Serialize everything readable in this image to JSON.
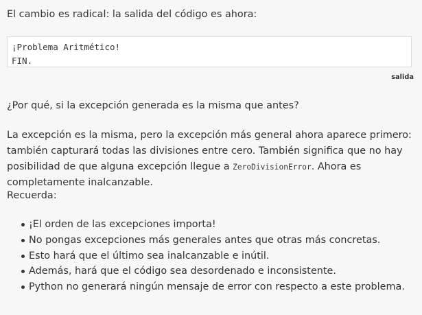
{
  "intro_text": "El cambio es radical: la salida del código es ahora:",
  "code_output": {
    "lines": [
      "¡Problema Aritmético!",
      "FIN."
    ],
    "label": "salida"
  },
  "question_text": "¿Por qué, si la excepción generada es la misma que antes?",
  "explanation": {
    "before_code": "La excepción es la misma, pero la excepción más general ahora aparece primero: también capturará todas las divisiones entre cero. También significa que no hay posibilidad de que alguna excepción llegue a ",
    "code": "ZeroDivisionError",
    "after_code": ". Ahora es completamente inalcanzable."
  },
  "remember_label": "Recuerda:",
  "bullets": [
    "¡El orden de las excepciones importa!",
    "No pongas excepciones más generales antes que otras más concretas.",
    "Esto hará que el último sea inalcanzable e inútil.",
    "Además, hará que el código sea desordenado e inconsistente.",
    "Python no generará ningún mensaje de error con respecto a este problema."
  ]
}
